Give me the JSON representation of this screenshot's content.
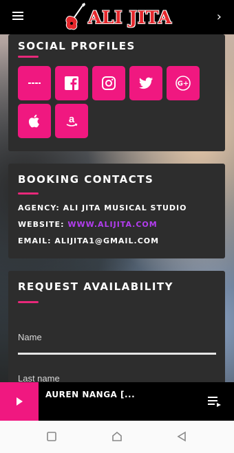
{
  "app": {
    "brand_name": "ALI JITA",
    "menu_icon": "hamburger-icon",
    "next_icon": "chevron-right-icon"
  },
  "social": {
    "title": "SOCIAL PROFILES",
    "buttons": [
      {
        "icon": "dashes-icon",
        "label": "",
        "icon_text": "—"
      },
      {
        "icon": "facebook-icon",
        "label": "Facebook"
      },
      {
        "icon": "instagram-icon",
        "label": "Instagram"
      },
      {
        "icon": "twitter-icon",
        "label": "Twitter"
      },
      {
        "icon": "google-plus-icon",
        "label": "Google+",
        "icon_text": "G+"
      },
      {
        "icon": "apple-icon",
        "label": "Apple"
      },
      {
        "icon": "amazon-icon",
        "label": "Amazon",
        "icon_text": "a"
      }
    ]
  },
  "booking": {
    "title": "BOOKING CONTACTS",
    "agency_label": "AGENCY:",
    "agency_value": "ALI JITA MUSICAL STUDIO",
    "website_label": "WEBSITE:",
    "website_value": "WWW.ALIJITA.COM",
    "email_label": "EMAIL:",
    "email_value": "ALIJITA1@GMAIL.COM"
  },
  "request": {
    "title": "REQUEST AVAILABILITY",
    "name_label": "Name",
    "last_name_label": "Last name"
  },
  "player": {
    "track_title": "AUREN NANGA [..."
  },
  "colors": {
    "accent": "#f01880",
    "card": "#2d2d2d",
    "link": "#b33df0",
    "brand_red": "#e4272c"
  }
}
